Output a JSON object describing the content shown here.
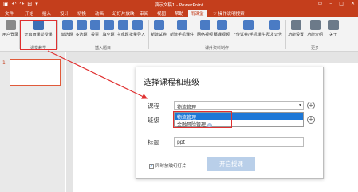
{
  "titlebar": {
    "doc_title": "演示文稿1 - PowerPoint",
    "qat": [
      "▣",
      "↶",
      "↷",
      "⊞",
      "▾"
    ],
    "win": [
      "▭",
      "–",
      "□",
      "✕"
    ]
  },
  "tabs": [
    {
      "label": "文件"
    },
    {
      "label": "开始"
    },
    {
      "label": "插入"
    },
    {
      "label": "设计"
    },
    {
      "label": "切换"
    },
    {
      "label": "动画"
    },
    {
      "label": "幻灯片放映"
    },
    {
      "label": "审阅"
    },
    {
      "label": "视图"
    },
    {
      "label": "帮助"
    },
    {
      "label": "雨课堂"
    },
    {
      "label": "♡ 操作说明搜索"
    }
  ],
  "ribbon": {
    "buttons": [
      {
        "label": "开启雨课堂授课",
        "color": "#3d6fb5"
      },
      {
        "label": "单选题",
        "color": "#4a7bc4"
      },
      {
        "label": "多选题",
        "color": "#4a7bc4"
      },
      {
        "label": "投票",
        "color": "#4a7bc4"
      },
      {
        "label": "填空题",
        "color": "#4a7bc4"
      },
      {
        "label": "主观题",
        "color": "#4a7bc4"
      },
      {
        "label": "批量导入",
        "color": "#4a7bc4"
      },
      {
        "label": "新建试卷",
        "color": "#4a7bc4"
      },
      {
        "label": "新建手机课件",
        "color": "#4a7bc4"
      },
      {
        "label": "网络视频",
        "color": "#4a7bc4"
      },
      {
        "label": "慕课视频",
        "color": "#4a7bc4"
      },
      {
        "label": "上传试卷/手机课件",
        "color": "#4a7bc4"
      },
      {
        "label": "群发公告",
        "color": "#4a7bc4"
      },
      {
        "label": "功能设置",
        "color": "#6c7a89"
      },
      {
        "label": "功能介绍",
        "color": "#6c7a89"
      },
      {
        "label": "关于",
        "color": "#6c7a89"
      }
    ],
    "groups": [
      "课堂教学",
      "插入题目",
      "课外资料制作",
      "更多"
    ],
    "user_label": "用户登录"
  },
  "slidepane": {
    "slide_number": "1"
  },
  "slide": {
    "title_fragment": "题"
  },
  "dialog": {
    "title": "选择课程和班级",
    "course_label": "课程",
    "course_value": "物流管理",
    "class_label": "班级",
    "title_label": "标题",
    "title_value": "ppt",
    "dropdown_options": [
      {
        "label": "物流管理",
        "selected": true
      },
      {
        "label": "金融风险管理",
        "badge": "@",
        "selected": false
      }
    ],
    "sync_checkbox_label": "同时放映幻灯片",
    "sync_checked": true,
    "start_button": "开启授课",
    "plus": "+"
  },
  "colors": {
    "brand": "#c43e1c",
    "highlight": "#e03030",
    "selection": "#1e78d7",
    "button_disabled": "#b9cfe9"
  }
}
